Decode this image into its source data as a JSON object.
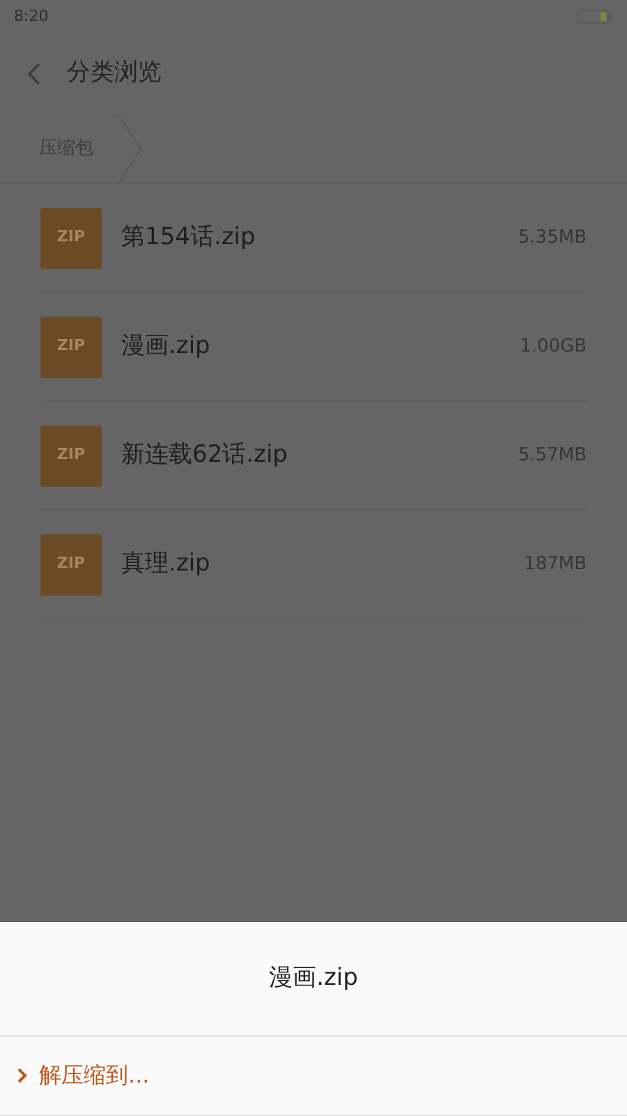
{
  "status_bar": {
    "time": "8:20"
  },
  "header": {
    "title": "分类浏览"
  },
  "breadcrumb": [
    "压缩包"
  ],
  "files": [
    {
      "icon_label": "ZIP",
      "name": "第154话.zip",
      "size": "5.35MB"
    },
    {
      "icon_label": "ZIP",
      "name": "漫画.zip",
      "size": "1.00GB"
    },
    {
      "icon_label": "ZIP",
      "name": "新连载62话.zip",
      "size": "5.57MB"
    },
    {
      "icon_label": "ZIP",
      "name": "真理.zip",
      "size": "187MB"
    }
  ],
  "sheet": {
    "title": "漫画.zip",
    "actions": [
      {
        "label": "解压缩到..."
      }
    ]
  }
}
